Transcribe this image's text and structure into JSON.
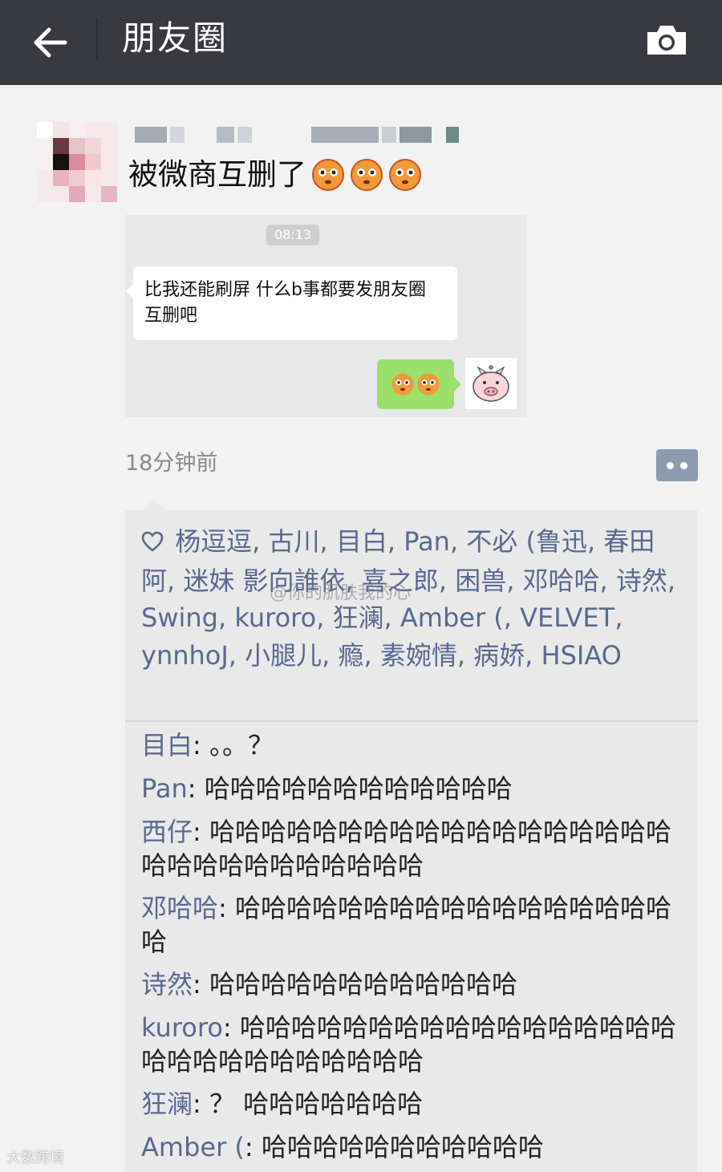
{
  "header": {
    "title": "朋友圈",
    "back_icon": "arrow-left-icon",
    "camera_icon": "camera-icon",
    "background": "#393a3f"
  },
  "post": {
    "text": "被微商互删了",
    "emoji": "blushing-face-icon",
    "time_ago": "18分钟前"
  },
  "screenshot": {
    "time": "08:13",
    "bubble_text": "比我还能刷屏 什么b事都要发朋友圈 互删吧"
  },
  "likes": {
    "text": "杨逗逗, 古川, 目白, Pan, 不必 (鲁迅, 春田阿, 迷妹 影向誰依, 喜之郎, 困兽, 邓哈哈, 诗然, Swing, kuroro, 狂澜, Amber (, VELVET, ynnhoJ, 小腿儿, 瘾, 素婉情, 病娇, HSIAO"
  },
  "watermark": "@你的肌肤我的心",
  "comments": [
    {
      "author": "目白",
      "text": "。。？",
      "link": false
    },
    {
      "author": "Pan",
      "text": "哈哈哈哈哈哈哈哈哈哈哈哈",
      "link": false
    },
    {
      "author": "西仔",
      "text": "哈哈哈哈哈哈哈哈哈哈哈哈哈哈哈哈哈哈哈哈哈哈哈哈哈哈哈哈哈",
      "link": true
    },
    {
      "author": "邓哈哈",
      "text": "哈哈哈哈哈哈哈哈哈哈哈哈哈哈哈哈哈哈",
      "link": true
    },
    {
      "author": "诗然",
      "text": "哈哈哈哈哈哈哈哈哈哈哈哈",
      "link": true
    },
    {
      "author": "kuroro",
      "text": "哈哈哈哈哈哈哈哈哈哈哈哈哈哈哈哈哈哈哈哈哈哈哈哈哈哈哈哈",
      "link": true
    },
    {
      "author": "狂澜",
      "text": "？ 哈哈哈哈哈哈哈",
      "link": true
    },
    {
      "author": "Amber (",
      "text": "哈哈哈哈哈哈哈哈哈哈哈",
      "link": true
    }
  ],
  "footer_mark": "大数跨境",
  "colors": {
    "link": "#59698f",
    "panel": "#e9e9ea",
    "green_bubble": "#9ae06a"
  }
}
